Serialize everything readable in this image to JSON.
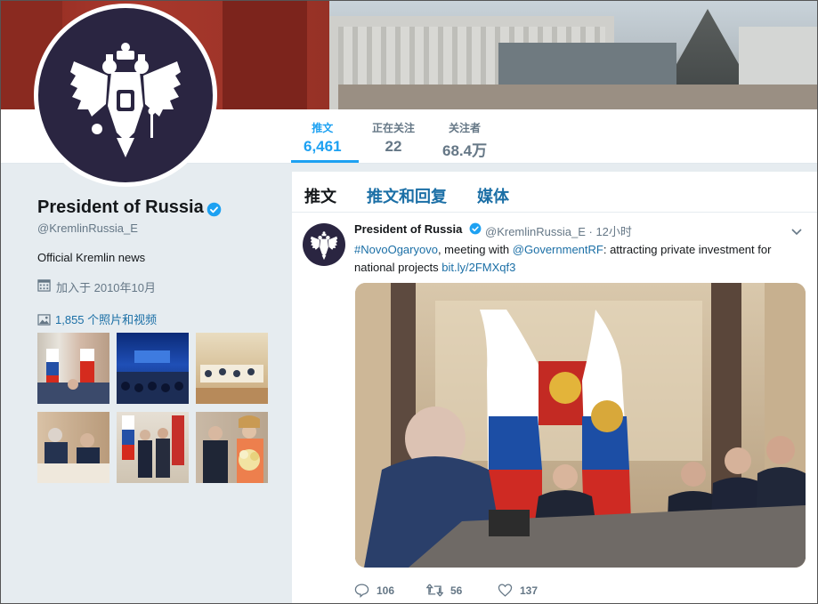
{
  "profile": {
    "name": "President of Russia",
    "handle": "@KremlinRussia_E",
    "bio": "Official Kremlin news",
    "joined": "加入于 2010年10月",
    "photos_link": "1,855 个照片和视频"
  },
  "stats": [
    {
      "label": "推文",
      "value": "6,461"
    },
    {
      "label": "正在关注",
      "value": "22"
    },
    {
      "label": "关注者",
      "value": "68.4万"
    }
  ],
  "tabs": [
    "推文",
    "推文和回复",
    "媒体"
  ],
  "tweet": {
    "name": "President of Russia",
    "handle_time": "@KremlinRussia_E · 12小时",
    "hashtag": "#NovoOgaryovo",
    "text1": ", meeting with ",
    "mention": "@GovernmentRF",
    "text2": ": attracting private investment for national projects ",
    "link": "bit.ly/2FMXqf3",
    "replies": "106",
    "retweets": "56",
    "likes": "137"
  },
  "icons": {
    "verified": "verified-badge-icon",
    "calendar": "calendar-icon",
    "photo": "photo-icon",
    "reply": "reply-icon",
    "retweet": "retweet-icon",
    "like": "heart-icon",
    "caret": "chevron-down-icon"
  },
  "colors": {
    "accent": "#1da1f2",
    "link": "#1b6fa6",
    "avatar_bg": "#2a2541"
  }
}
